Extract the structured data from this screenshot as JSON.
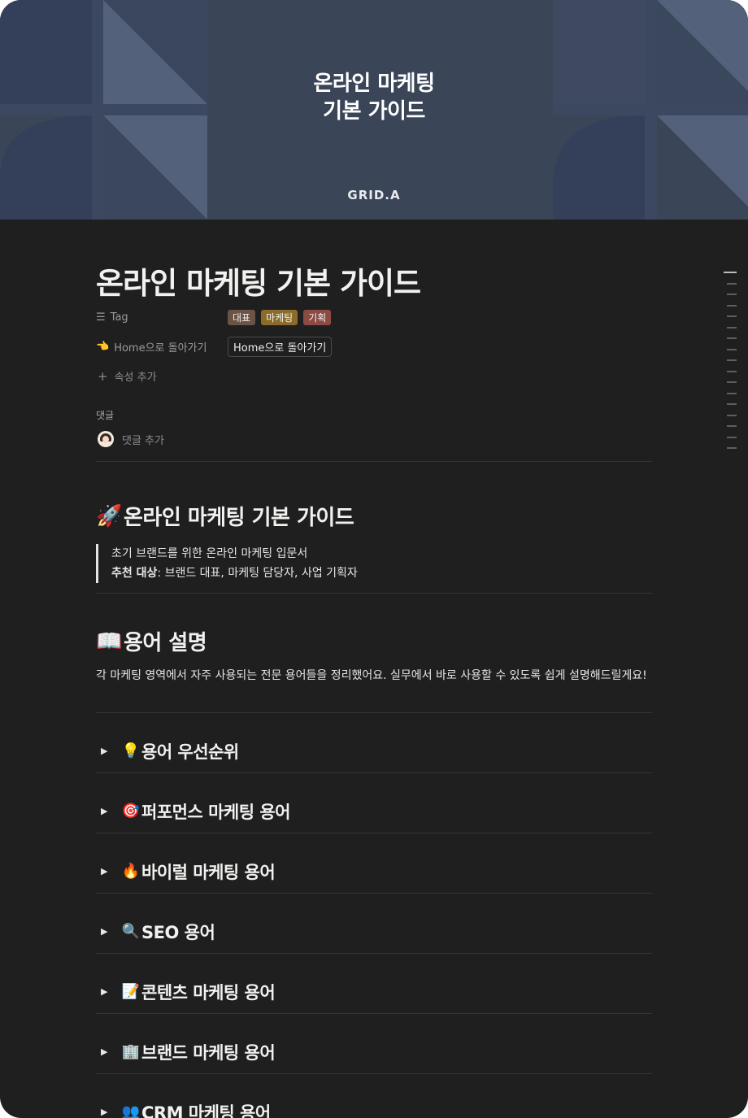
{
  "cover": {
    "title_line1": "온라인 마케팅",
    "title_line2": "기본 가이드",
    "brand": "GRID.A",
    "colors": {
      "background": "#3a4558",
      "shape": "#4e5b71"
    }
  },
  "page": {
    "title": "온라인 마케팅 기본 가이드",
    "properties": {
      "tag_label": "Tag",
      "tags": [
        {
          "label": "대표",
          "color": "#6b5346"
        },
        {
          "label": "마케팅",
          "color": "#8a6b2a"
        },
        {
          "label": "기획",
          "color": "#8c4a43"
        }
      ],
      "home_label": "Home으로 돌아가기",
      "home_value": "Home으로 돌아가기",
      "add_property": "속성 추가"
    },
    "comments": {
      "label": "댓글",
      "add_comment": "댓글 추가"
    }
  },
  "content": {
    "guide_heading": {
      "icon": "rocket-icon",
      "emoji": "🚀",
      "text": "온라인 마케팅 기본 가이드"
    },
    "quote": {
      "line1": "초기 브랜드를 위한 온라인 마케팅 입문서",
      "target_label": "추천 대상",
      "target_value": ": 브랜드 대표, 마케팅 담당자, 사업 기획자"
    },
    "terms_heading": {
      "icon": "open-book-icon",
      "emoji": "📖",
      "text": "용어 설명"
    },
    "terms_description": "각 마케팅 영역에서 자주 사용되는 전문 용어들을 정리했어요. 실무에서 바로 사용할 수 있도록 쉽게 설명해드릴게요!",
    "toggles": [
      {
        "icon": "lightbulb-icon",
        "emoji": "💡",
        "label": "용어 우선순위"
      },
      {
        "icon": "target-icon",
        "emoji": "🎯",
        "label": "퍼포먼스 마케팅 용어"
      },
      {
        "icon": "fire-icon",
        "emoji": "🔥",
        "label": "바이럴 마케팅 용어"
      },
      {
        "icon": "magnifier-icon",
        "emoji": "🔍",
        "label": "SEO 용어"
      },
      {
        "icon": "memo-icon",
        "emoji": "📝",
        "label": "콘텐츠 마케팅 용어"
      },
      {
        "icon": "office-building-icon",
        "emoji": "🏢",
        "label": "브랜드 마케팅 용어"
      },
      {
        "icon": "people-icon",
        "emoji": "👥",
        "label": "CRM 마케팅 용어"
      }
    ]
  }
}
